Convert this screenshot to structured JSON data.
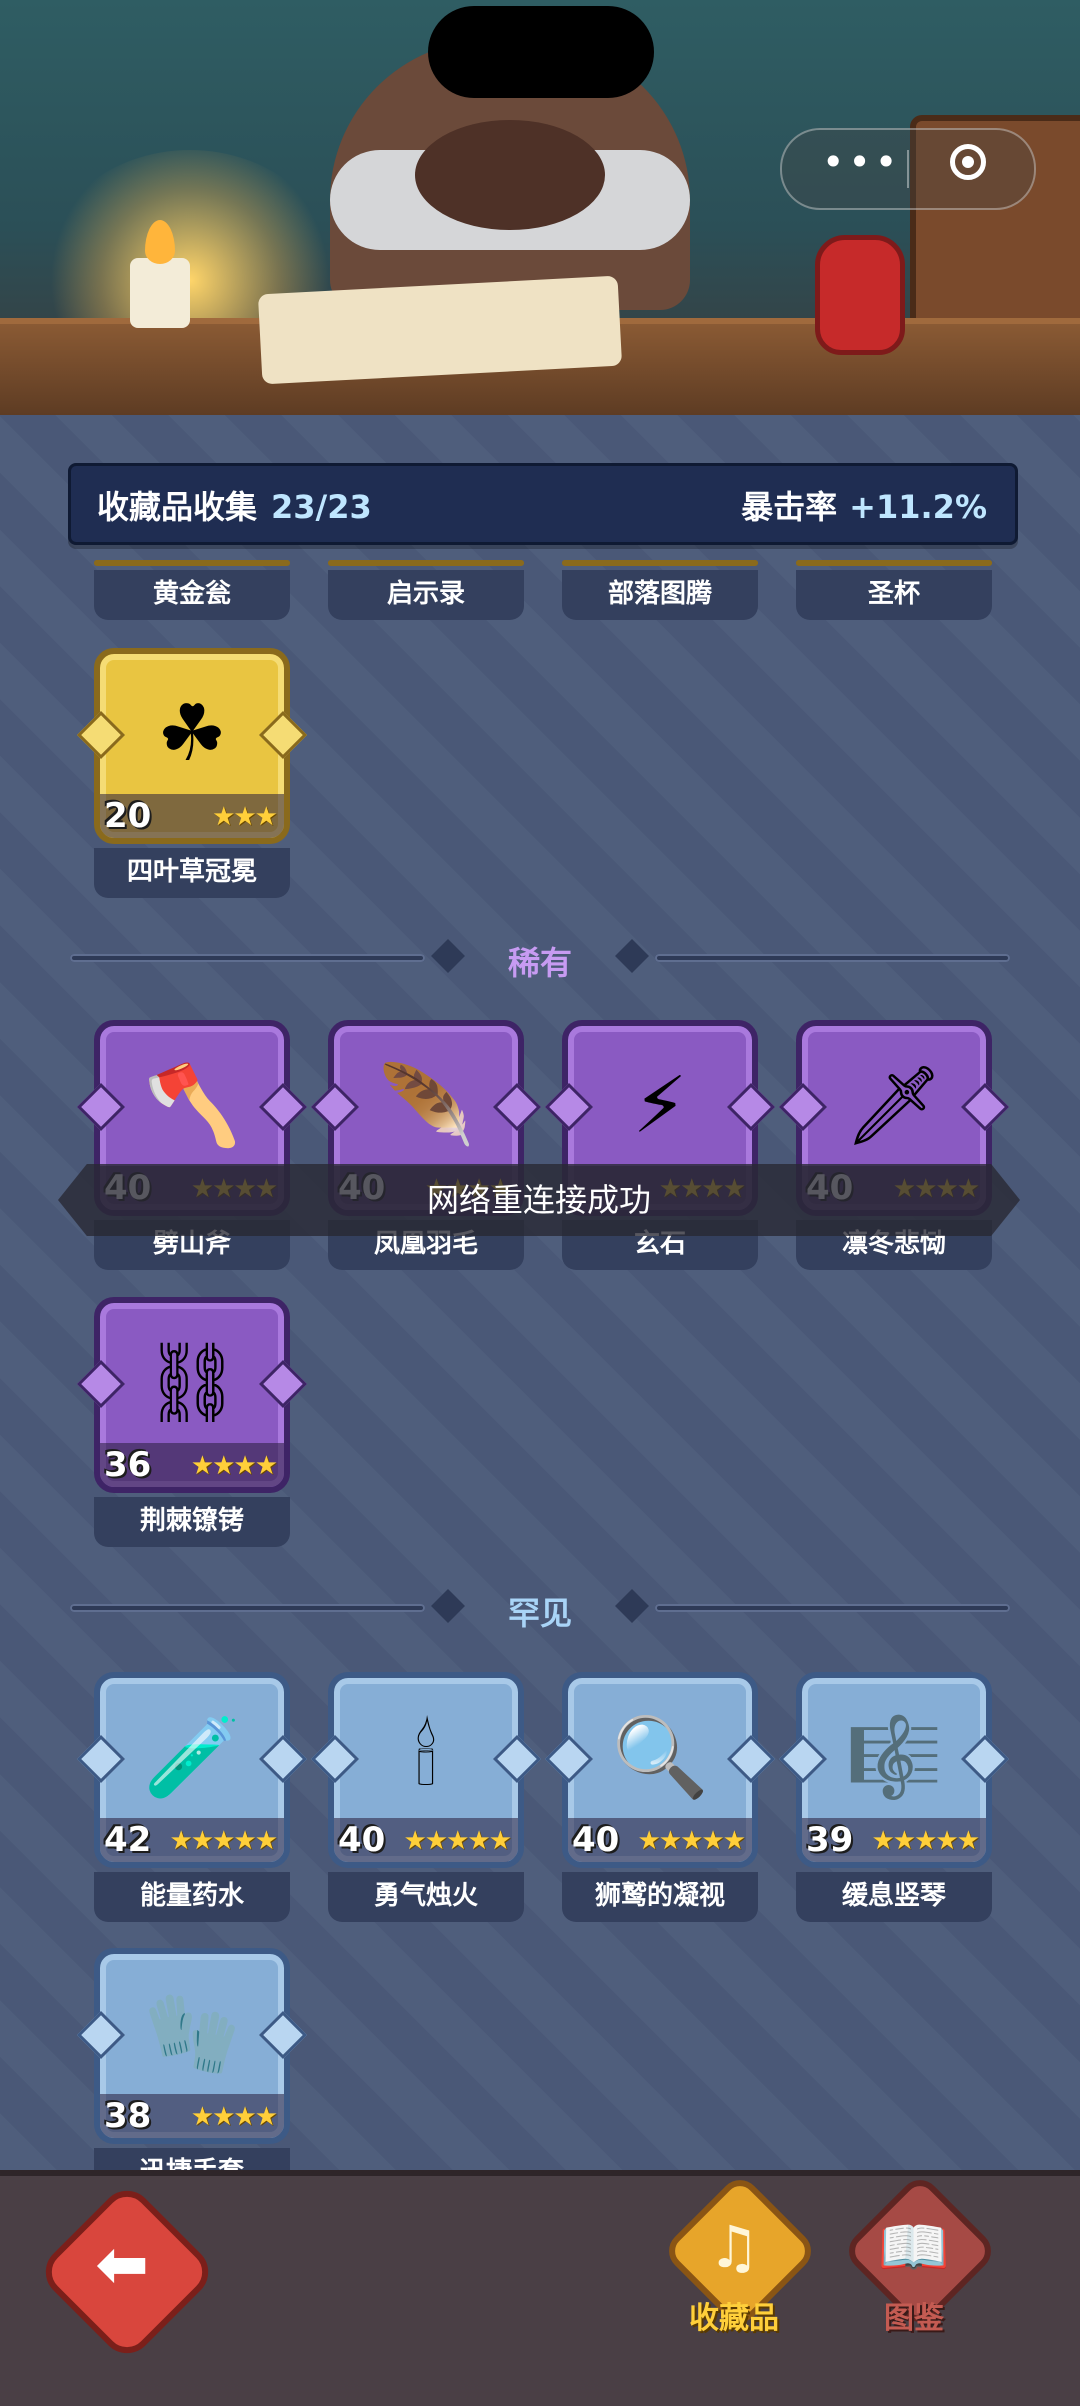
{
  "header": {
    "title": "收藏品收集",
    "count": "23/23",
    "crit_label": "暴击率",
    "crit_value": "+11.2%"
  },
  "legendary_partial": [
    {
      "name": "黄金瓮"
    },
    {
      "name": "启示录"
    },
    {
      "name": "部落图腾"
    },
    {
      "name": "圣杯"
    }
  ],
  "legendary_full": [
    {
      "name": "四叶草冠冕",
      "level": "20",
      "stars": "★★★",
      "icon": "clover-crown-icon"
    }
  ],
  "sections": {
    "rare": "稀有",
    "uncommon": "罕见"
  },
  "rare_items": [
    {
      "name": "劈山斧",
      "level": "40",
      "stars": "★★★★",
      "icon": "axe-icon"
    },
    {
      "name": "凤凰羽毛",
      "level": "40",
      "stars": "★★★★",
      "icon": "phoenix-feather-icon"
    },
    {
      "name": "玄石",
      "level": "",
      "stars": "★★★★",
      "icon": "mystic-stone-icon"
    },
    {
      "name": "凛冬悲恸",
      "level": "40",
      "stars": "★★★★",
      "icon": "winter-dagger-icon"
    },
    {
      "name": "荆棘镣铐",
      "level": "36",
      "stars": "★★★★",
      "icon": "thorn-shackles-icon"
    }
  ],
  "uncommon_items": [
    {
      "name": "能量药水",
      "level": "42",
      "stars": "★★★★★",
      "icon": "potion-icon"
    },
    {
      "name": "勇气烛火",
      "level": "40",
      "stars": "★★★★★",
      "icon": "candle-icon"
    },
    {
      "name": "狮鹫的凝视",
      "level": "40",
      "stars": "★★★★★",
      "icon": "magnifier-icon"
    },
    {
      "name": "缓息竖琴",
      "level": "39",
      "stars": "★★★★★",
      "icon": "lyre-icon"
    },
    {
      "name": "迅捷手套",
      "level": "38",
      "stars": "★★★★",
      "icon": "glove-icon"
    }
  ],
  "toast": "网络重连接成功",
  "nav": {
    "collection": "收藏品",
    "codex": "图鉴"
  },
  "colors": {
    "rare_label": "#c79bf2",
    "uncommon_label": "#a9d4f7",
    "active_nav": "#ffcf3a",
    "inactive_nav": "#c45b52"
  }
}
